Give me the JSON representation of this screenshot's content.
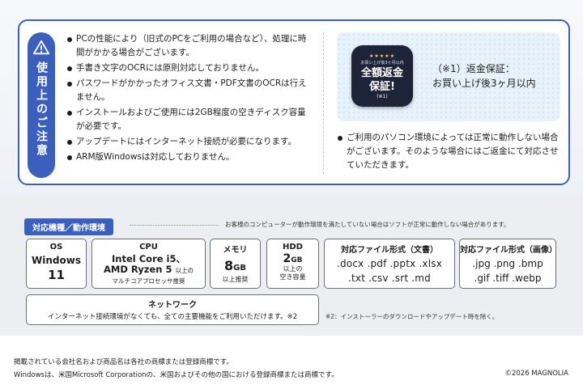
{
  "caution": {
    "title": "使用上のご注意",
    "notes": [
      "PCの性能により（旧式のPCをご利用の場合など）、処理に時間がかかる場合がございます。",
      "手書き文字のOCRには原則対応しておりません。",
      "パスワードがかかったオフィス文書・PDF文書のOCRは行えません。",
      "インストールおよびご使用には2GB程度の空きディスク容量が必要です。",
      "アップデートにはインターネット接続が必要になります。",
      "ARM版Windowsは対応しておりません。"
    ]
  },
  "guarantee": {
    "badge_stars": "★★★★★",
    "badge_small": "お買い上げ後3ヶ月以内",
    "badge_line1": "全額返金",
    "badge_line2": "保証!",
    "badge_note": "(※1)",
    "desc_line1": "（※1）返金保証：",
    "desc_line2": "お買い上げ後3ヶ月以内"
  },
  "env_note": "ご利用のパソコン環境によっては正常に動作しない場合がございます。そのような場合にはご返金にて対応させていただきます。",
  "specs": {
    "header": "対応機種／動作環境",
    "caption": "お客様のコンピューターが動作環境を満たしていない場合はソフトが正常に動作しない場合があります。",
    "os": {
      "label": "OS",
      "value1": "Windows",
      "value2": "11"
    },
    "cpu": {
      "label": "CPU",
      "value1": "Intel Core i5、",
      "value2": "AMD Ryzen 5",
      "value2_suffix": "以上の",
      "value3": "マルチコアプロセッサ推奨"
    },
    "memory": {
      "label": "メモリ",
      "value": "8",
      "unit": "GB",
      "note": "以上推奨"
    },
    "hdd": {
      "label": "HDD",
      "value": "2",
      "unit": "GB",
      "note1": "以上の",
      "note2": "空き容量"
    },
    "doc_formats": {
      "label": "対応ファイル形式（文書）",
      "row1": ".docx .pdf .pptx .xlsx",
      "row2": ".txt .csv .srt .md"
    },
    "img_formats": {
      "label": "対応ファイル形式（画像）",
      "row1": ".jpg .png .bmp",
      "row2": ".gif .tiff .webp"
    },
    "network": {
      "label": "ネットワーク",
      "value": "インターネット接続環境がなくても、全ての主要機能をご利用いただけます。※2"
    },
    "network_note": "※2：インストーラーのダウンロードやアップデート時を除く。"
  },
  "footer": {
    "line1": "掲載されている会社名および商品名は各社の商標または登録商標です。",
    "line2": "Windowsは、米国Microsoft Corporationの、米国およびその他の国における登録商標または商標です。",
    "copyright": "©2026 MAGNOLIA"
  },
  "colors": {
    "accent": "#3a5fbd",
    "badge_bg": "#1e2438",
    "panel_bg": "#eceef1"
  }
}
